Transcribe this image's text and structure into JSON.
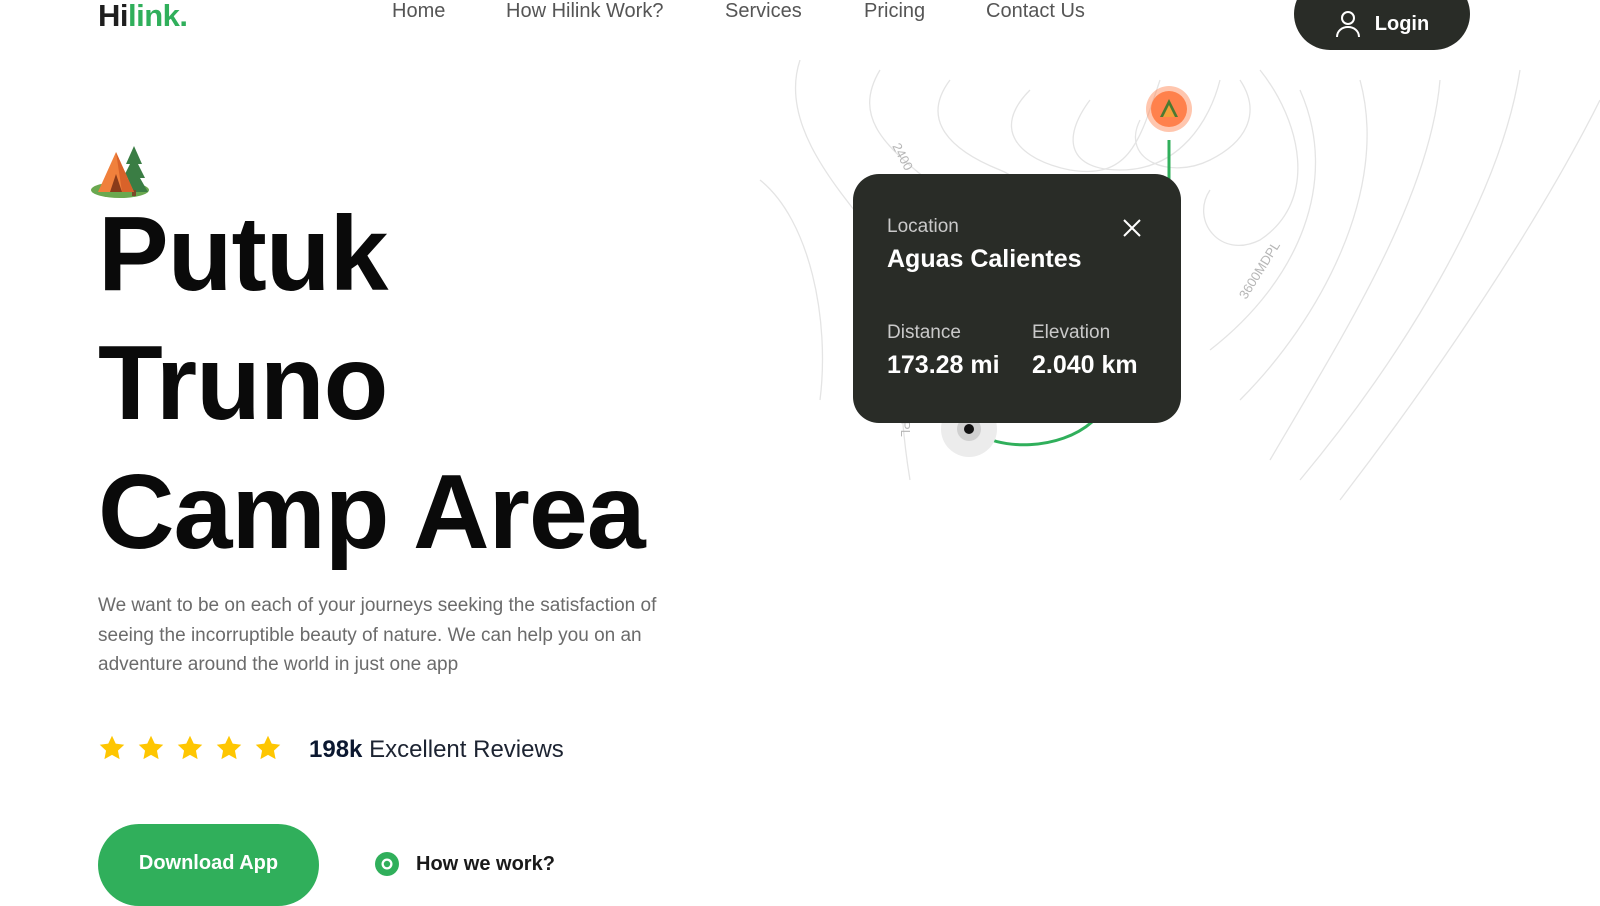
{
  "brand": {
    "part1": "Hi",
    "part2": "link."
  },
  "nav": {
    "items": [
      "Home",
      "How Hilink Work?",
      "Services",
      "Pricing",
      "Contact Us"
    ]
  },
  "header": {
    "login_label": "Login"
  },
  "hero": {
    "title_lines": [
      "Putuk",
      "Truno",
      "Camp Area"
    ],
    "description": "We want to be on each of your journeys seeking the satisfaction of seeing the incorruptible beauty of nature. We can help you on an adventure around the world in just one app",
    "rating": {
      "stars": 5,
      "count": "198k",
      "label": "Excellent Reviews"
    },
    "download_label": "Download App",
    "how_label": "How we work?"
  },
  "map": {
    "contour_labels": [
      "2400",
      "3600MDPL",
      "PL"
    ],
    "card": {
      "location_label": "Location",
      "location_value": "Aguas Calientes",
      "distance_label": "Distance",
      "distance_value": "173.28 mi",
      "elevation_label": "Elevation",
      "elevation_value": "2.040 km"
    }
  },
  "colors": {
    "brand_green": "#30af5b",
    "dark": "#292c27",
    "star": "#fec601",
    "pin": "#ff814c"
  }
}
